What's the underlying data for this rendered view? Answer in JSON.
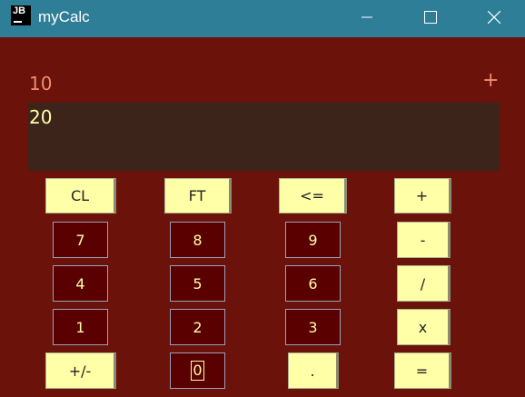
{
  "window": {
    "title": "myCalc",
    "icon_label": "JB",
    "controls": [
      "minimize-icon",
      "maximize-icon",
      "close-icon"
    ]
  },
  "previous_operand": "10",
  "operator": "+",
  "display_value": "20",
  "buttons": {
    "clear": "CL",
    "ft": "FT",
    "backspace": "<=",
    "plus": "+",
    "minus": "-",
    "divide": "/",
    "multiply": "x",
    "equals": "=",
    "negate": "+/-",
    "decimal": ".",
    "d0": "0",
    "d1": "1",
    "d2": "2",
    "d3": "3",
    "d4": "4",
    "d5": "5",
    "d6": "6",
    "d7": "7",
    "d8": "8",
    "d9": "9"
  },
  "colors": {
    "background": "#6b130a",
    "titlebar": "#2f7e98",
    "display_bg": "#3c241a",
    "display_text": "#ffffa8",
    "accent_text": "#f08c6e",
    "function_button": "#ffffa8",
    "digit_button": "#5a0000"
  }
}
